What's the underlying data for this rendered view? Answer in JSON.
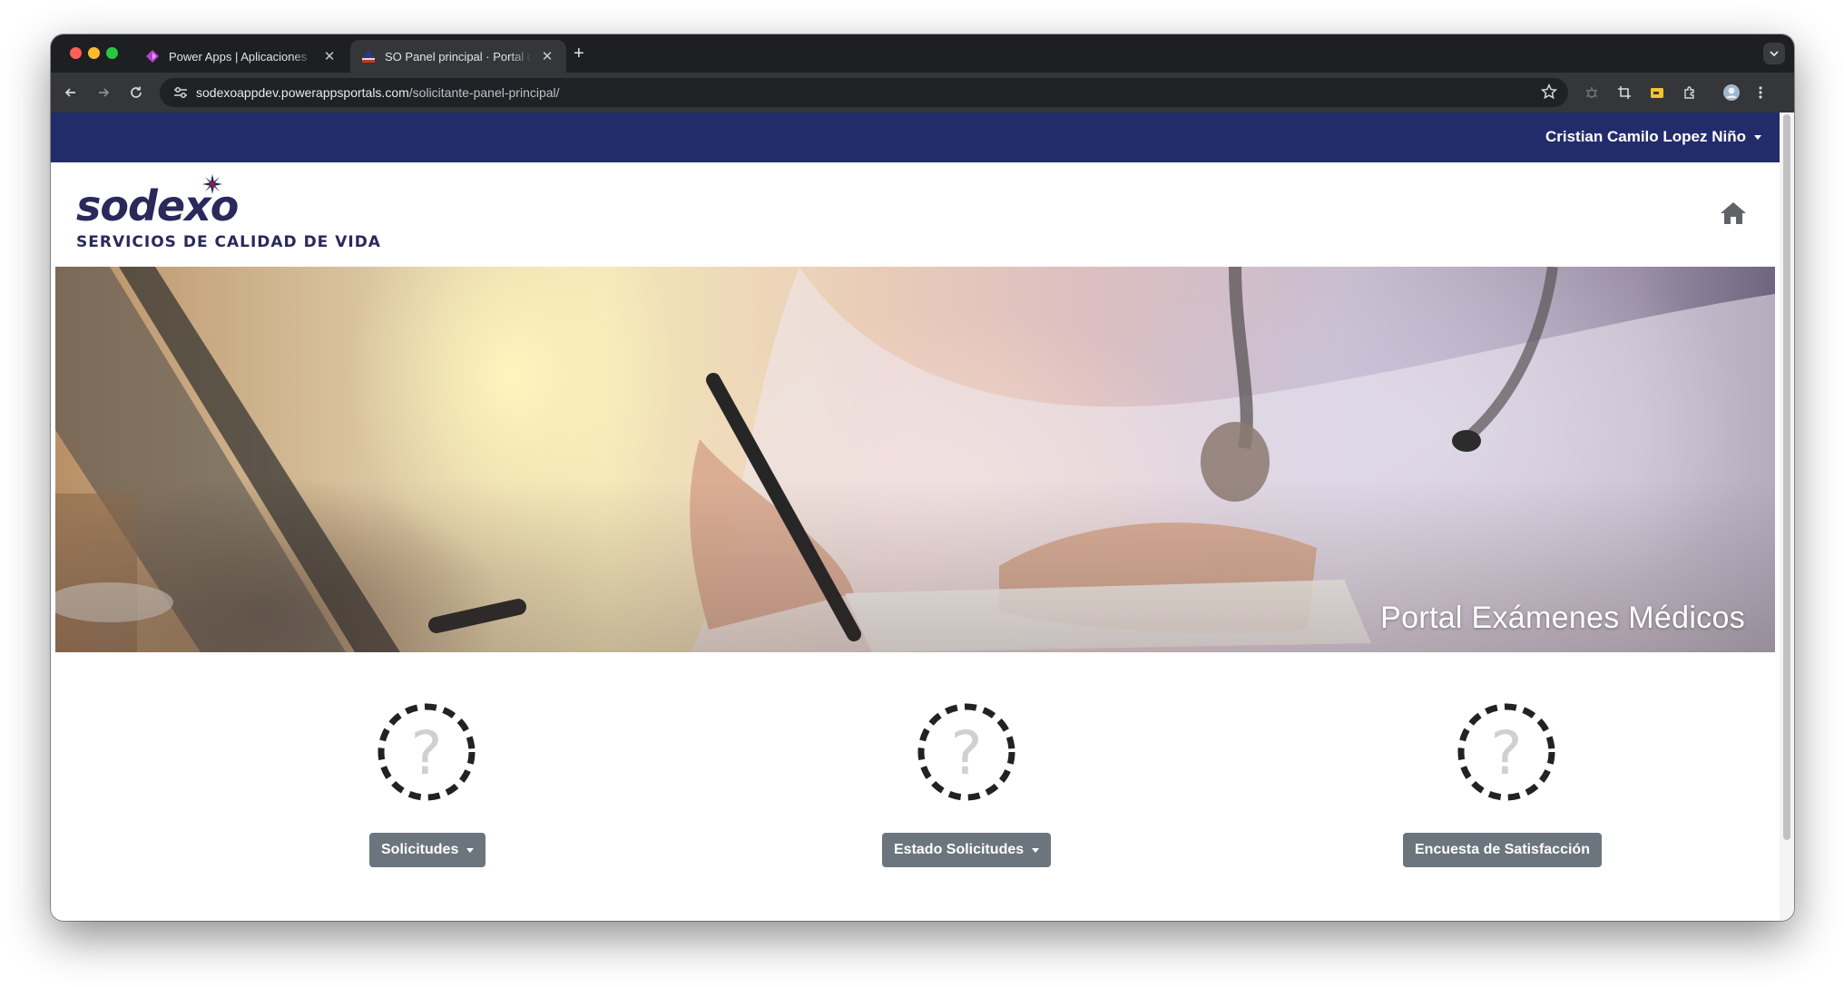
{
  "browser": {
    "tabs": [
      {
        "title": "Power Apps | Aplicaciones",
        "active": false
      },
      {
        "title": "SO Panel principal · Portal de Exámenes Médicos",
        "active": true
      }
    ],
    "new_tab_label": "+",
    "url_host": "sodexoappdev.powerappsportals.com",
    "url_path": "/solicitante-panel-principal/"
  },
  "topbar": {
    "user_name": "Cristian Camilo Lopez Niño",
    "color": "#232c6b"
  },
  "header": {
    "logo_word": "sodexo",
    "logo_tagline": "SERVICIOS DE CALIDAD DE VIDA",
    "home_icon": "home-icon"
  },
  "hero": {
    "title": "Portal Exámenes Médicos"
  },
  "tiles": [
    {
      "label": "Solicitudes",
      "has_dropdown": true,
      "icon": "question-circle-icon"
    },
    {
      "label": "Estado Solicitudes",
      "has_dropdown": true,
      "icon": "question-circle-icon"
    },
    {
      "label": "Encuesta de Satisfacción",
      "has_dropdown": false,
      "icon": "question-circle-icon"
    }
  ],
  "colors": {
    "brand_navy": "#2a295c",
    "button_gray": "#6c757d"
  }
}
